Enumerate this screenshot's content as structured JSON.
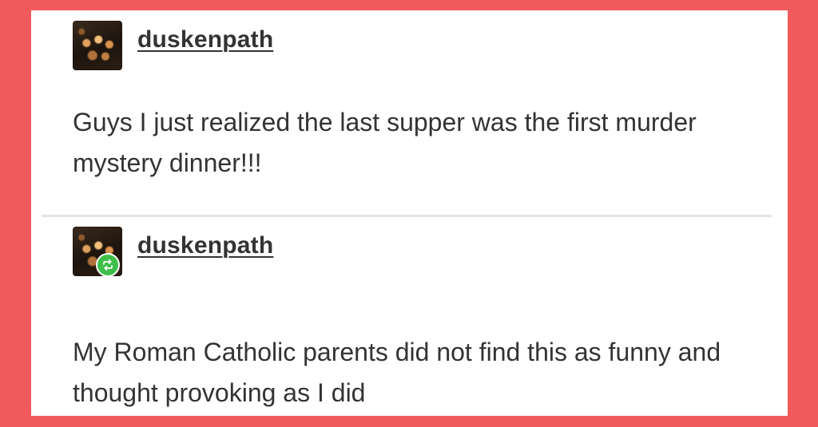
{
  "colors": {
    "background": "#f15a5c",
    "card": "#ffffff",
    "text": "#333333",
    "divider": "#e4e4e4",
    "reblog_badge": "#3fbf4a"
  },
  "posts": [
    {
      "username": "duskenpath",
      "avatar_icon": "avatar-image",
      "text": "Guys I just realized the last supper was the first murder mystery dinner!!!"
    },
    {
      "username": "duskenpath",
      "avatar_icon": "avatar-image",
      "badge_icon": "reblog-icon",
      "text": "My Roman Catholic parents did not find this as funny and thought provoking as I did"
    }
  ]
}
